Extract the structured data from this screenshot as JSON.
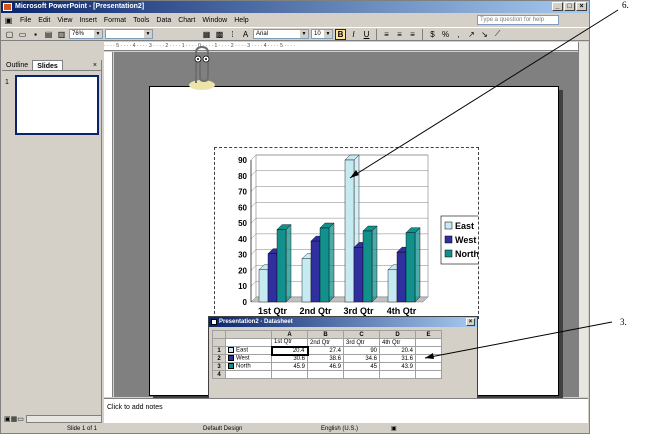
{
  "window": {
    "title": "Microsoft PowerPoint - [Presentation2]"
  },
  "menu": [
    "File",
    "Edit",
    "View",
    "Insert",
    "Format",
    "Tools",
    "Data",
    "Chart",
    "Window",
    "Help"
  ],
  "help_box": {
    "placeholder": "Type a question for help"
  },
  "toolbar": {
    "zoom": "76%",
    "font": "Arial",
    "font_size": "10",
    "bold": "B",
    "italic": "I",
    "underline": "U"
  },
  "slides_pane": {
    "tab_outline": "Outline",
    "tab_slides": "Slides",
    "close": "×",
    "slide_number": "1"
  },
  "notes": {
    "placeholder": "Click to add notes"
  },
  "status": {
    "slide": "Slide 1 of 1",
    "design": "Default Design",
    "language": "English (U.S.)"
  },
  "colors": {
    "east": "#c6eaf2",
    "west": "#2f2fa0",
    "north": "#12908c"
  },
  "chart_data": {
    "type": "bar",
    "categories": [
      "1st Qtr",
      "2nd Qtr",
      "3rd Qtr",
      "4th Qtr"
    ],
    "series": [
      {
        "name": "East",
        "values": [
          20.4,
          27.4,
          90,
          20.4
        ]
      },
      {
        "name": "West",
        "values": [
          30.6,
          38.6,
          34.6,
          31.6
        ]
      },
      {
        "name": "North",
        "values": [
          45.9,
          46.9,
          45,
          43.9
        ]
      }
    ],
    "ylim": [
      0,
      90
    ],
    "yticks": [
      "0",
      "10",
      "20",
      "30",
      "40",
      "50",
      "60",
      "70",
      "80",
      "90"
    ],
    "legend": "right",
    "grid": true
  },
  "datasheet": {
    "title": "Presentation2 - Datasheet",
    "col_letters": [
      "A",
      "B",
      "C",
      "D",
      "E"
    ],
    "headers": [
      "1st Qtr",
      "2nd Qtr",
      "3rd Qtr",
      "4th Qtr"
    ],
    "rows": [
      {
        "num": "1",
        "label": "East",
        "values": [
          "20.4",
          "27.4",
          "90",
          "20.4"
        ]
      },
      {
        "num": "2",
        "label": "West",
        "values": [
          "30.6",
          "38.6",
          "34.6",
          "31.6"
        ]
      },
      {
        "num": "3",
        "label": "North",
        "values": [
          "45.9",
          "46.9",
          "45",
          "43.9"
        ]
      },
      {
        "num": "4",
        "label": "",
        "values": [
          "",
          "",
          "",
          ""
        ]
      }
    ]
  },
  "annotations": {
    "top": "6.",
    "right": "3."
  }
}
